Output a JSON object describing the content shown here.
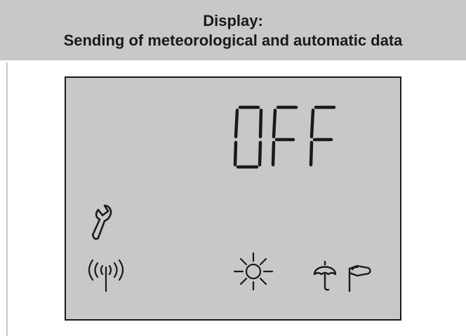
{
  "header": {
    "line1": "Display:",
    "line2": "Sending of meteorological and automatic data"
  },
  "lcd": {
    "readout": "OFF",
    "icons": [
      "wrench-icon",
      "antenna-signal-icon",
      "sun-icon",
      "umbrella-icon",
      "windsock-icon"
    ]
  },
  "colors": {
    "header_bg": "#c8c8c8",
    "lcd_bg": "#c8c8c8",
    "segment": "#1a1a1a"
  }
}
